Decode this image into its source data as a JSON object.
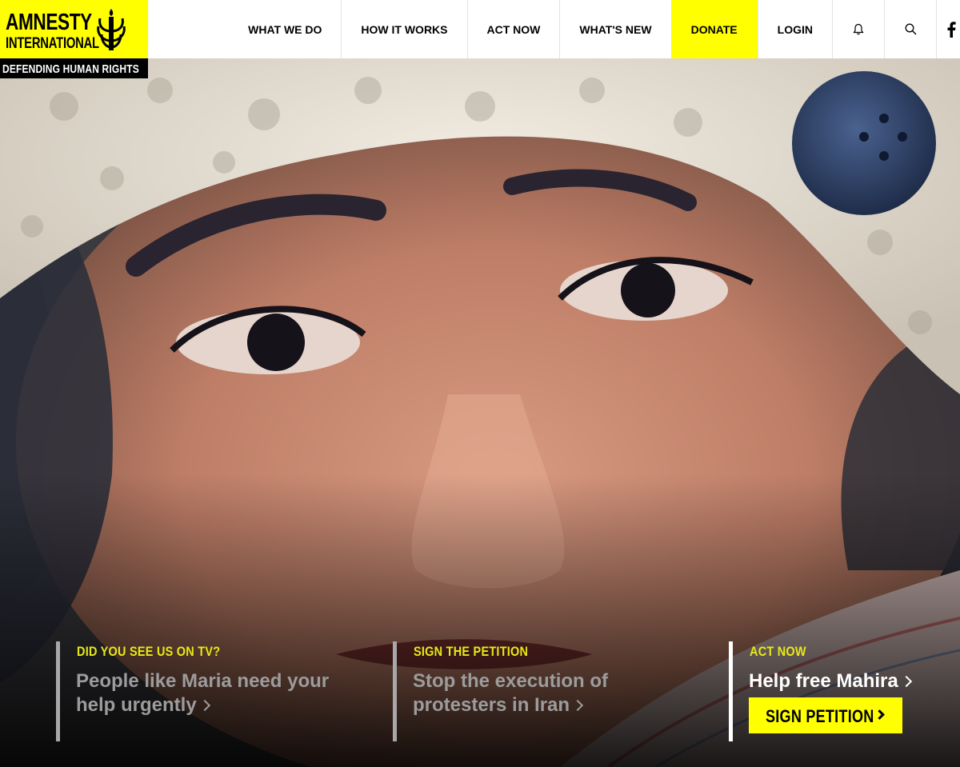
{
  "brand": {
    "line1": "AMNESTY",
    "line2": "INTERNATIONAL",
    "tagline": "DEFENDING HUMAN RIGHTS",
    "yellow": "#ffff00"
  },
  "nav": {
    "items": [
      {
        "label": "WHAT WE DO"
      },
      {
        "label": "HOW IT WORKS"
      },
      {
        "label": "ACT NOW"
      },
      {
        "label": "WHAT'S NEW"
      },
      {
        "label": "DONATE"
      },
      {
        "label": "LOGIN"
      }
    ],
    "icons": [
      "bell-icon",
      "search-icon",
      "facebook-icon"
    ]
  },
  "promos": [
    {
      "label": "DID YOU SEE US ON TV?",
      "title": "People like Maria need your help urgently"
    },
    {
      "label": "SIGN THE PETITION",
      "title": "Stop the execution of protesters in Iran"
    },
    {
      "label": "ACT NOW",
      "title": "Help free Mahira",
      "button": "SIGN PETITION"
    }
  ]
}
